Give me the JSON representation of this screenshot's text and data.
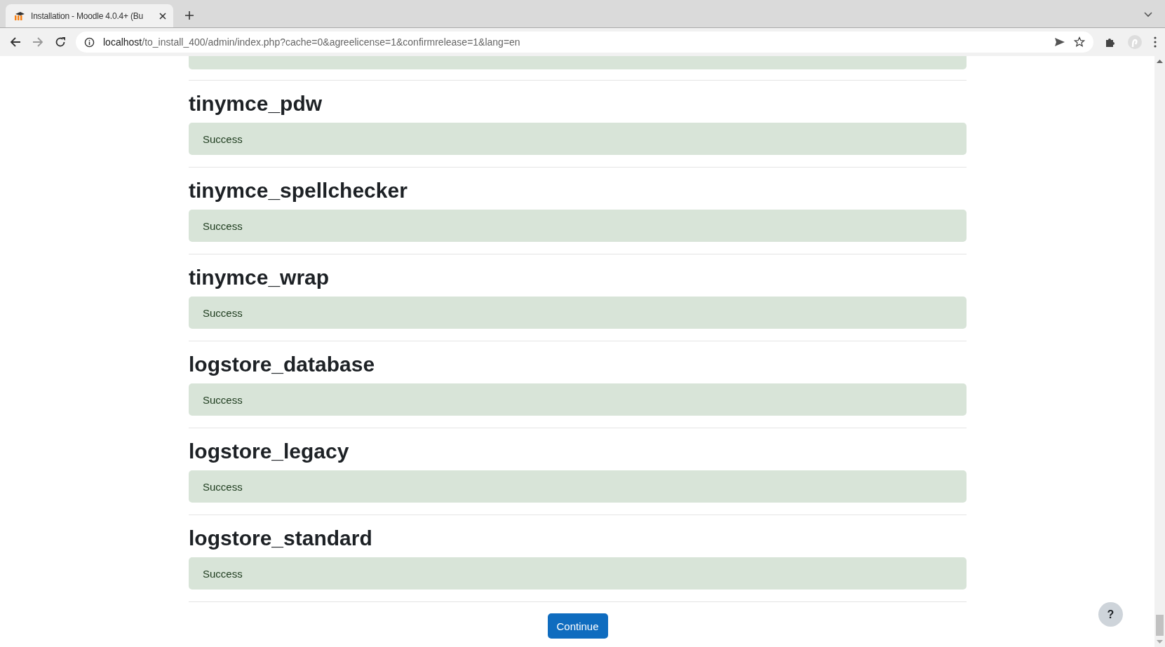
{
  "browser": {
    "tab_title": "Installation - Moodle 4.0.4+ (Bu",
    "url_host": "localhost",
    "url_path": "/to_install_400/admin/index.php?cache=0&agreelicense=1&confirmrelease=1&lang=en"
  },
  "sections": [
    {
      "title": "tinymce_pdw",
      "message": "Success"
    },
    {
      "title": "tinymce_spellchecker",
      "message": "Success"
    },
    {
      "title": "tinymce_wrap",
      "message": "Success"
    },
    {
      "title": "logstore_database",
      "message": "Success"
    },
    {
      "title": "logstore_legacy",
      "message": "Success"
    },
    {
      "title": "logstore_standard",
      "message": "Success"
    }
  ],
  "continue_button": "Continue",
  "help_button": "?"
}
